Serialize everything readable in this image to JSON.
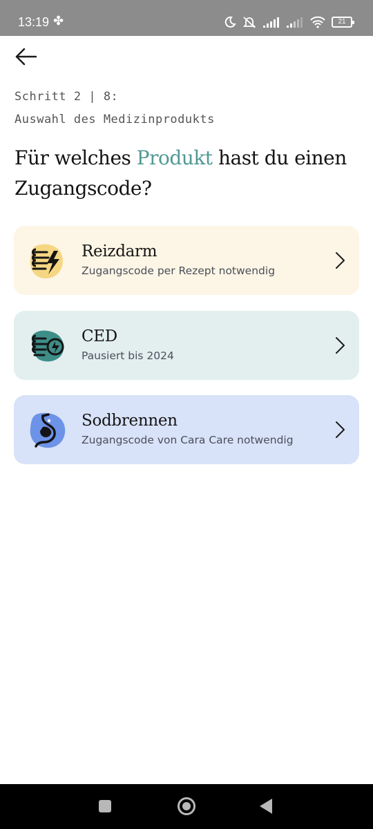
{
  "status_bar": {
    "time": "13:19",
    "battery": "21",
    "icons": [
      "fan-icon",
      "moon-icon",
      "mute-icon",
      "signal-icon",
      "signal-icon",
      "wifi-icon",
      "battery-icon"
    ]
  },
  "header": {
    "back_icon": "arrow-left-icon",
    "step": "Schritt 2 | 8:",
    "step_subtitle": "Auswahl des Medizinprodukts"
  },
  "title": {
    "before": "Für welches ",
    "accent": "Produkt",
    "after": " hast du einen Zugangscode?",
    "accent_color": "#4f9992"
  },
  "products": [
    {
      "name": "Reizdarm",
      "subtitle": "Zugangscode per Rezept notwendig",
      "icon": "intestine-lightning-icon",
      "background": "#fdf5e5",
      "icon_color": "#f5d682"
    },
    {
      "name": "CED",
      "subtitle": "Pausiert bis 2024",
      "icon": "intestine-fire-icon",
      "background": "#e3efef",
      "icon_color": "#3e8d88"
    },
    {
      "name": "Sodbrennen",
      "subtitle": "Zugangscode von Cara Care notwendig",
      "icon": "stomach-icon",
      "background": "#d8e2f8",
      "icon_color": "#6d93e8"
    }
  ],
  "nav_bar": {
    "icons": [
      "recents-icon",
      "home-icon",
      "back-icon"
    ]
  }
}
